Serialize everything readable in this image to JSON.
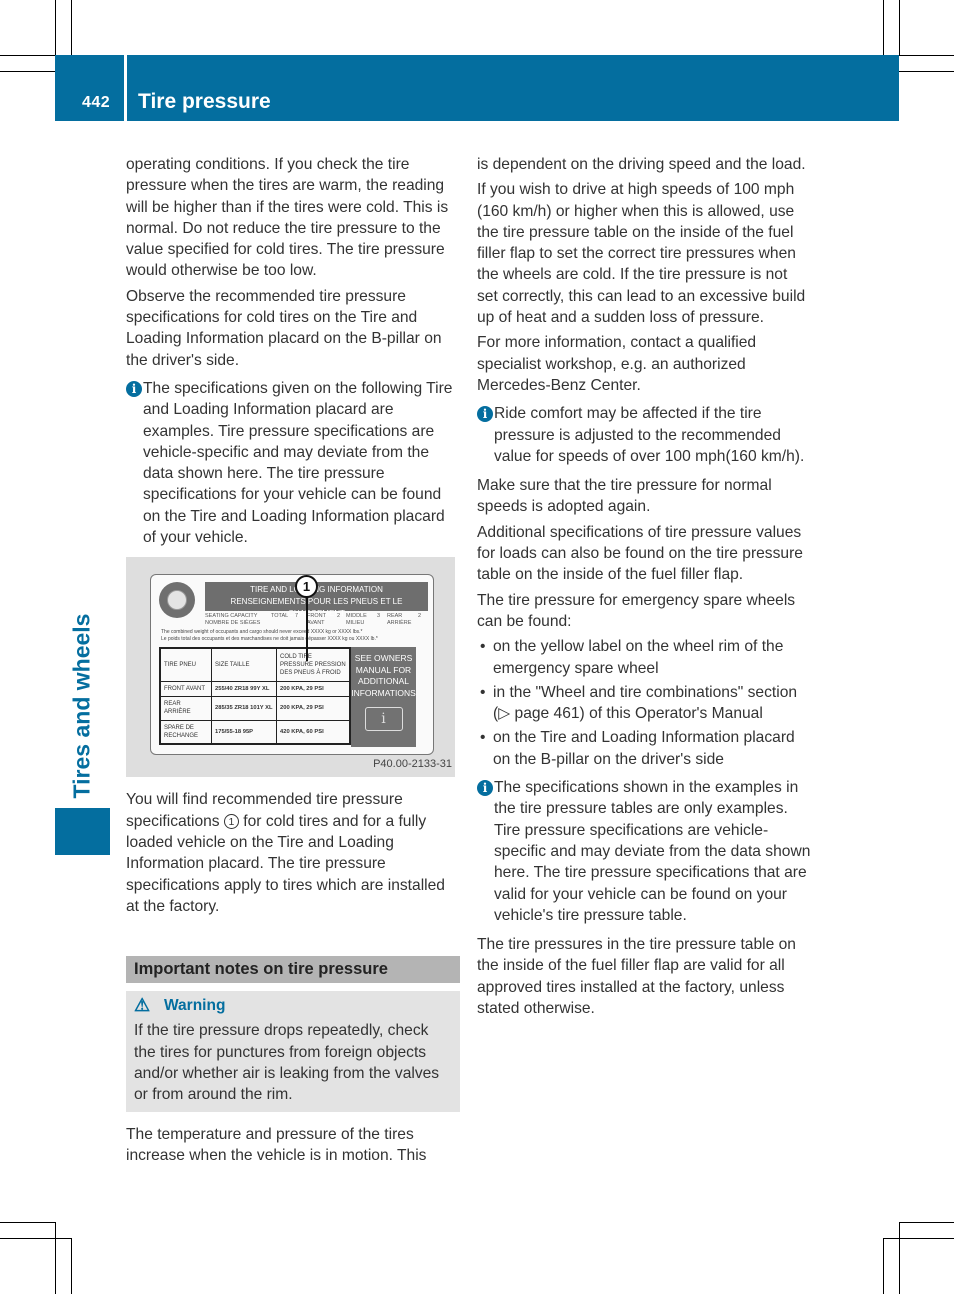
{
  "header": {
    "page_number": "442",
    "section_title": "Tire pressure",
    "chapter_tab": "Tires and wheels"
  },
  "colors": {
    "brand_blue": "#046e9f",
    "heading_gray": "#b4b4b4",
    "warning_bg": "#e3e3e3"
  },
  "left_column": {
    "para1": "operating conditions. If you check the tire pressure when the tires are warm, the reading will be higher than if the tires were cold. This is normal. Do not reduce the tire pressure to the value specified for cold tires. The tire pressure would otherwise be too low.",
    "para2": "Observe the recommended tire pressure specifications for cold tires on the Tire and Loading Information placard on the B-pillar on the driver's side.",
    "info1": "The specifications given on the following Tire and Loading Information placard are examples. Tire pressure specifications are vehicle-specific and may deviate from the data shown here. The tire pressure specifications for your vehicle can be found on the Tire and Loading Information placard of your vehicle.",
    "figure": {
      "code": "P40.00-2133-31",
      "callout": "1",
      "placard": {
        "title_en": "TIRE AND LOADING INFORMATION",
        "title_fr": "RENSEIGNEMENTS POUR LES PNEUS ET LE CHARGEMENT",
        "seating_label": "SEATING CAPACITY NOMBRE DE SIÈGES",
        "total_label": "TOTAL",
        "total_value": "7",
        "front_label": "FRONT AVANT",
        "front_value": "2",
        "middle_label": "MIDDLE MILIEU",
        "middle_value": "3",
        "rear_label": "REAR ARRIÈRE",
        "rear_value": "2",
        "note_en": "The combined weight of occupants and cargo should never exceed XXXX kg or XXXX lbs.*",
        "note_fr": "Le poids total des occupants et des marchandises ne doit jamais dépasser XXXX kg ou XXXX lb.*",
        "table_headers": [
          "TIRE PNEU",
          "SIZE TAILLE",
          "COLD TIRE PRESSURE PRESSION DES PNEUS À FROID"
        ],
        "rows": [
          {
            "tire": "FRONT AVANT",
            "size": "255/40 ZR18 99Y XL",
            "pressure": "200 KPA, 29 PSI"
          },
          {
            "tire": "REAR ARRIÈRE",
            "size": "285/35 ZR18 101Y XL",
            "pressure": "200 KPA, 29 PSI"
          },
          {
            "tire": "SPARE DE RECHANGE",
            "size": "175/55-18 95P",
            "pressure": "420 KPA, 60 PSI"
          }
        ],
        "side_text": "SEE OWNERS MANUAL FOR ADDITIONAL INFORMATIONS",
        "book_icon": "manual-book-icon"
      }
    },
    "para3_before": "You will find recommended tire pressure specifications",
    "para3_marker": "1",
    "para3_after": "for cold tires and for a fully loaded vehicle on the Tire and Loading Information placard. The tire pressure specifications apply to tires which are installed at the factory.",
    "subheading": "Important notes on tire pressure",
    "warning": {
      "icon": "warning-triangle-icon",
      "title": "Warning",
      "text": "If the tire pressure drops repeatedly, check the tires for punctures from foreign objects and/or whether air is leaking from the valves or from around the rim."
    },
    "para4": "The temperature and pressure of the tires increase when the vehicle is in motion. This"
  },
  "right_column": {
    "para1": "is dependent on the driving speed and the load.",
    "para2": "If you wish to drive at high speeds of 100 mph (160 km/h) or higher when this is allowed, use the tire pressure table on the inside of the fuel filler flap to set the correct tire pressures when the wheels are cold. If the tire pressure is not set correctly, this can lead to an excessive build up of heat and a sudden loss of pressure.",
    "para3": "For more information, contact a qualified specialist workshop, e.g. an authorized Mercedes-Benz Center.",
    "info1": "Ride comfort may be affected if the tire pressure is adjusted to the recommended value for speeds of over 100 mph(160 km/h).",
    "para4": "Make sure that the tire pressure for normal speeds is adopted again.",
    "para5": "Additional specifications of tire pressure values for loads can also be found on the tire pressure table on the inside of the fuel filler flap.",
    "para6": "The tire pressure for emergency spare wheels can be found:",
    "bullets": [
      "on the yellow label on the wheel rim of the emergency spare wheel",
      "in the \"Wheel and tire combinations\" section (▷ page 461) of this Operator's Manual",
      "on the Tire and Loading Information placard on the B-pillar on the driver's side"
    ],
    "info2": "The specifications shown in the examples in the tire pressure tables are only examples. Tire pressure specifications are vehicle-specific and may deviate from the data shown here. The tire pressure specifications that are valid for your vehicle can be found on your vehicle's tire pressure table.",
    "para7": "The tire pressures in the tire pressure table on the inside of the fuel filler flap are valid for all approved tires installed at the factory, unless stated otherwise."
  }
}
